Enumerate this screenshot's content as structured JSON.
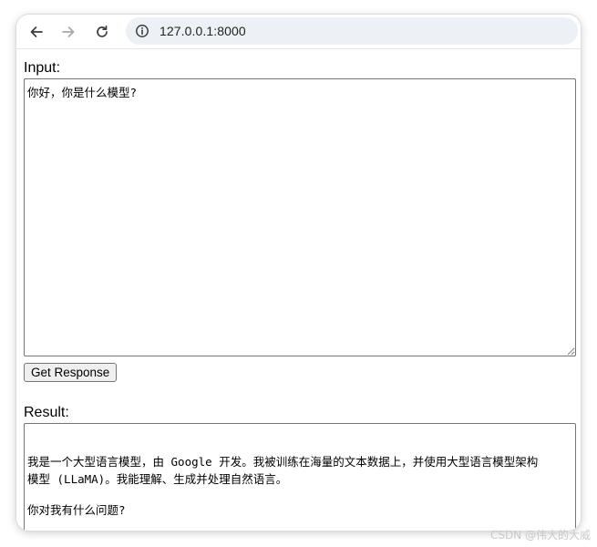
{
  "browser": {
    "url": "127.0.0.1:8000",
    "icons": {
      "back": "arrow-left-icon",
      "forward": "arrow-right-icon",
      "reload": "reload-icon",
      "site_info": "info-icon"
    }
  },
  "form": {
    "input_label": "Input:",
    "input_value": "你好，你是什么模型?",
    "button_label": "Get Response",
    "result_label": "Result:",
    "result_lines": [
      "我是一个大型语言模型，由 Google 开发。我被训练在海量的文本数据上，并使用大型语言模型架构",
      "模型 (LLaMA)。我能理解、生成并处理自然语言。",
      "你对我有什么问题?"
    ]
  },
  "watermark": "CSDN @伟大的大威"
}
